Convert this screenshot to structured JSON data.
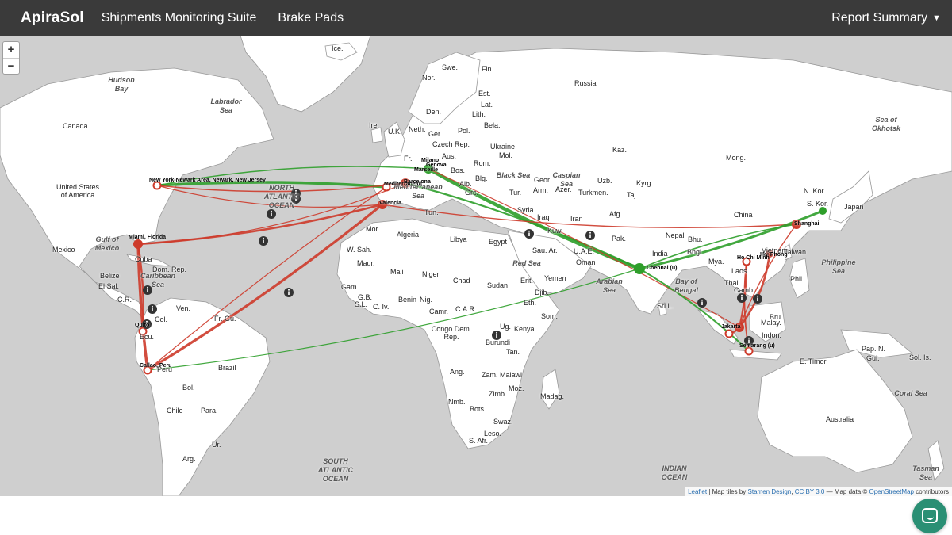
{
  "header": {
    "brand": "ApiraSol",
    "suite": "Shipments Monitoring Suite",
    "product": "Brake Pads",
    "report_label": "Report Summary"
  },
  "map": {
    "zoom_in": "+",
    "zoom_out": "−",
    "attribution": {
      "leaflet": "Leaflet",
      "tiles_prefix": " | Map tiles by ",
      "stamen": "Stamen Design",
      "comma": ", ",
      "license": "CC BY 3.0",
      "data_prefix": " — Map data © ",
      "osm": "OpenStreetMap",
      "suffix": " contributors"
    },
    "countries": [
      "Ice.",
      "Swe.",
      "Nor.",
      "Fin.",
      "Russia",
      "Est.",
      "Lat.",
      "Den.",
      "Lith.",
      "Ire.",
      "U.K.",
      "Neth.",
      "Pol.",
      "Bela.",
      "Ger.",
      "Czech Rep.",
      "Ukraine",
      "Aus.",
      "Mol.",
      "Rom.",
      "Kaz.",
      "Mong.",
      "Canada",
      "United States of America",
      "Fr.",
      "Bos.",
      "Alb.",
      "Grc.",
      "Blg.",
      "Geor.",
      "Arm.",
      "Azer.",
      "Uzb.",
      "Kyrg.",
      "Turkmen.",
      "Taj.",
      "Tur.",
      "Syria",
      "Iraq",
      "Iran",
      "Afg.",
      "Kuw.",
      "Pak.",
      "Nepal",
      "Bhu.",
      "China",
      "N. Kor.",
      "S. Kor.",
      "Japan",
      "Taiwan",
      "Tun.",
      "Mor.",
      "Algeria",
      "Libya",
      "Egypt",
      "Sau. Ar.",
      "Oman",
      "U.A.E.",
      "Yemen",
      "India",
      "Bngl.",
      "Mya.",
      "Laos",
      "Thai.",
      "Camb.",
      "Phil.",
      "Malay.",
      "Bru.",
      "Indon.",
      "Sri L.",
      "W. Sah.",
      "Maur.",
      "Mali",
      "Niger",
      "Chad",
      "Sudan",
      "Erit.",
      "Djib.",
      "Eth.",
      "Som.",
      "Gam.",
      "G.B.",
      "S.L.",
      "C. Iv.",
      "Benin",
      "Nig.",
      "Camr.",
      "C.A.R.",
      "Congo Dem. Rep.",
      "Ug.",
      "Kenya",
      "Burundi",
      "Tan.",
      "Ang.",
      "Zam.",
      "Malawi",
      "Moz.",
      "Zimb.",
      "Madag.",
      "Nmb.",
      "Bots.",
      "Swaz.",
      "Leso.",
      "S. Afr.",
      "Mexico",
      "Cuba",
      "Dom. Rep.",
      "Belize",
      "El Sal.",
      "C.R.",
      "Ven.",
      "Col.",
      "Fr. Gu.",
      "Ecu.",
      "Peru",
      "Brazil",
      "Bol.",
      "Chile",
      "Para.",
      "Ur.",
      "Arg.",
      "Pap. N.",
      "Gui.",
      "Sol. Is.",
      "E. Timor",
      "Australia",
      "Vietnam"
    ],
    "seas": [
      "Hudson Bay",
      "Labrador Sea",
      "NORTH ATLANTIC OCEAN",
      "Gulf of Mexico",
      "Caribbean Sea",
      "Mediterranean Sea",
      "Black Sea",
      "Caspian Sea",
      "Red Sea",
      "Arabian Sea",
      "Bay of Bengal",
      "Philippine Sea",
      "Sea of Okhotsk",
      "SOUTH ATLANTIC OCEAN",
      "INDIAN OCEAN",
      "Coral Sea",
      "Tasman Sea"
    ],
    "cities": [
      "New York-Newark Area, Newark, New Jersey",
      "Miami, Florida",
      "Quito",
      "Callao, Peru",
      "Milano",
      "Mediterranean",
      "Valencia",
      "Barcelona",
      "Shanghai",
      "Chennai (u)",
      "Jakarta",
      "Semarang (u)",
      "Hai Phong",
      "Ho Chi Minh",
      "Marseille",
      "Genova"
    ],
    "route_colors": {
      "late": "#cd3a2a",
      "ontime": "#2e9e2a",
      "info_marker": "#333333"
    }
  },
  "chat": {
    "icon": "chat-icon"
  }
}
